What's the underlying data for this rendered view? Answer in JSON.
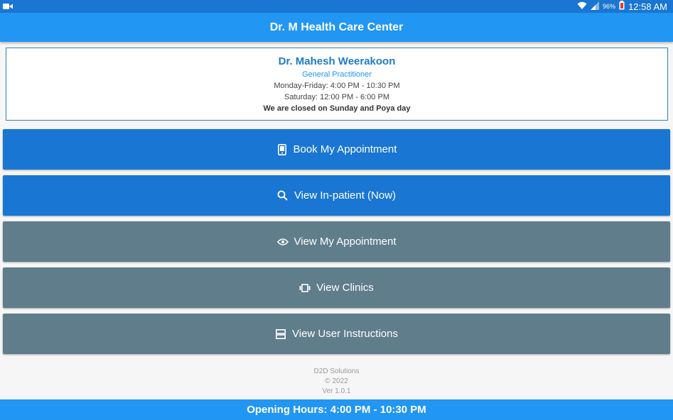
{
  "status_bar": {
    "battery_percent": "96%",
    "time": "12:58 AM",
    "icons": [
      "video-camera-icon",
      "wifi-icon",
      "signal-icon",
      "battery-icon"
    ]
  },
  "app_bar": {
    "title": "Dr. M Health Care Center"
  },
  "info": {
    "doctor_name": "Dr. Mahesh Weerakoon",
    "doctor_title": "General Practitioner",
    "weekday_hours": "Monday-Friday: 4:00 PM - 10:30 PM",
    "saturday_hours": "Saturday: 12:00 PM - 6:00 PM",
    "closed_note": "We are closed on Sunday and Poya day"
  },
  "buttons": [
    {
      "label": "Book My Appointment",
      "icon": "phone-icon",
      "color": "#1976d2"
    },
    {
      "label": "View In-patient (Now)",
      "icon": "search-icon",
      "color": "#1976d2"
    },
    {
      "label": "View My Appointment",
      "icon": "eye-icon",
      "color": "#607d8b"
    },
    {
      "label": "View Clinics",
      "icon": "carousel-icon",
      "color": "#607d8b"
    },
    {
      "label": "View User Instructions",
      "icon": "list-icon",
      "color": "#607d8b"
    }
  ],
  "footer": {
    "company": "D2D Solutions",
    "copyright": "© 2022",
    "version": "Ver 1.0.1"
  },
  "bottom_bar": {
    "text": "Opening Hours: 4:00 PM - 10:30 PM"
  },
  "colors": {
    "primary": "#2196f3",
    "primary_dark": "#1976d2",
    "grey_button": "#607d8b"
  }
}
